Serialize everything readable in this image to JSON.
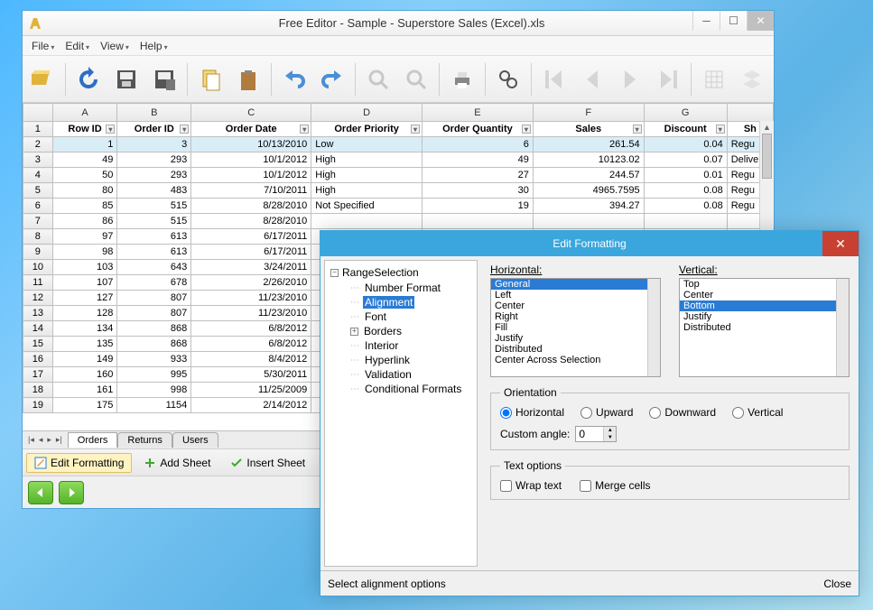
{
  "window": {
    "title": "Free Editor - Sample - Superstore Sales (Excel).xls",
    "menus": [
      "File",
      "Edit",
      "View",
      "Help"
    ]
  },
  "toolbar_icons": [
    "open",
    "refresh",
    "save",
    "saveas",
    "copy",
    "paste",
    "undo",
    "redo",
    "zoomin",
    "zoomout",
    "print",
    "find",
    "first",
    "prev",
    "next",
    "last",
    "grid",
    "overlay"
  ],
  "sheet": {
    "col_letters": [
      "A",
      "B",
      "C",
      "D",
      "E",
      "F",
      "G",
      ""
    ],
    "headers": [
      "Row ID",
      "Order ID",
      "Order Date",
      "Order Priority",
      "Order Quantity",
      "Sales",
      "Discount",
      "Sh"
    ],
    "rows": [
      {
        "n": 2,
        "sel": true,
        "c": [
          "1",
          "3",
          "10/13/2010",
          "Low",
          "6",
          "261.54",
          "0.04",
          "Regu"
        ]
      },
      {
        "n": 3,
        "c": [
          "49",
          "293",
          "10/1/2012",
          "High",
          "49",
          "10123.02",
          "0.07",
          "Delive"
        ]
      },
      {
        "n": 4,
        "c": [
          "50",
          "293",
          "10/1/2012",
          "High",
          "27",
          "244.57",
          "0.01",
          "Regu"
        ]
      },
      {
        "n": 5,
        "c": [
          "80",
          "483",
          "7/10/2011",
          "High",
          "30",
          "4965.7595",
          "0.08",
          "Regu"
        ]
      },
      {
        "n": 6,
        "c": [
          "85",
          "515",
          "8/28/2010",
          "Not Specified",
          "19",
          "394.27",
          "0.08",
          "Regu"
        ]
      },
      {
        "n": 7,
        "c": [
          "86",
          "515",
          "8/28/2010",
          "",
          "",
          "",
          "",
          ""
        ]
      },
      {
        "n": 8,
        "c": [
          "97",
          "613",
          "6/17/2011",
          "",
          "",
          "",
          "",
          ""
        ]
      },
      {
        "n": 9,
        "c": [
          "98",
          "613",
          "6/17/2011",
          "",
          "",
          "",
          "",
          ""
        ]
      },
      {
        "n": 10,
        "c": [
          "103",
          "643",
          "3/24/2011",
          "",
          "",
          "",
          "",
          ""
        ]
      },
      {
        "n": 11,
        "c": [
          "107",
          "678",
          "2/26/2010",
          "",
          "",
          "",
          "",
          ""
        ]
      },
      {
        "n": 12,
        "c": [
          "127",
          "807",
          "11/23/2010",
          "",
          "",
          "",
          "",
          ""
        ]
      },
      {
        "n": 13,
        "c": [
          "128",
          "807",
          "11/23/2010",
          "",
          "",
          "",
          "",
          ""
        ]
      },
      {
        "n": 14,
        "c": [
          "134",
          "868",
          "6/8/2012",
          "",
          "",
          "",
          "",
          ""
        ]
      },
      {
        "n": 15,
        "c": [
          "135",
          "868",
          "6/8/2012",
          "",
          "",
          "",
          "",
          ""
        ]
      },
      {
        "n": 16,
        "c": [
          "149",
          "933",
          "8/4/2012",
          "",
          "",
          "",
          "",
          ""
        ]
      },
      {
        "n": 17,
        "c": [
          "160",
          "995",
          "5/30/2011",
          "",
          "",
          "",
          "",
          ""
        ]
      },
      {
        "n": 18,
        "c": [
          "161",
          "998",
          "11/25/2009",
          "",
          "",
          "",
          "",
          ""
        ]
      },
      {
        "n": 19,
        "c": [
          "175",
          "1154",
          "2/14/2012",
          "",
          "",
          "",
          "",
          ""
        ]
      }
    ],
    "tabs": [
      "Orders",
      "Returns",
      "Users"
    ]
  },
  "bottombar": {
    "editfmt": "Edit Formatting",
    "addsheet": "Add Sheet",
    "insertsheet": "Insert Sheet"
  },
  "dialog": {
    "title": "Edit Formatting",
    "tree_root": "RangeSelection",
    "tree_items": [
      "Number Format",
      "Alignment",
      "Font",
      "Borders",
      "Interior",
      "Hyperlink",
      "Validation",
      "Conditional Formats"
    ],
    "tree_selected": "Alignment",
    "tree_expandable": "Borders",
    "horizontal_label": "Horizontal:",
    "vertical_label": "Vertical:",
    "h_opts": [
      "General",
      "Left",
      "Center",
      "Right",
      "Fill",
      "Justify",
      "Distributed",
      "Center Across Selection"
    ],
    "h_sel": "General",
    "v_opts": [
      "Top",
      "Center",
      "Bottom",
      "Justify",
      "Distributed"
    ],
    "v_sel": "Bottom",
    "orient_legend": "Orientation",
    "orient_opts": [
      "Horizontal",
      "Upward",
      "Downward",
      "Vertical"
    ],
    "orient_sel": "Horizontal",
    "angle_label": "Custom angle:",
    "angle_val": "0",
    "textopt_legend": "Text options",
    "wrap_label": "Wrap text",
    "merge_label": "Merge cells",
    "status": "Select alignment options",
    "close": "Close"
  }
}
